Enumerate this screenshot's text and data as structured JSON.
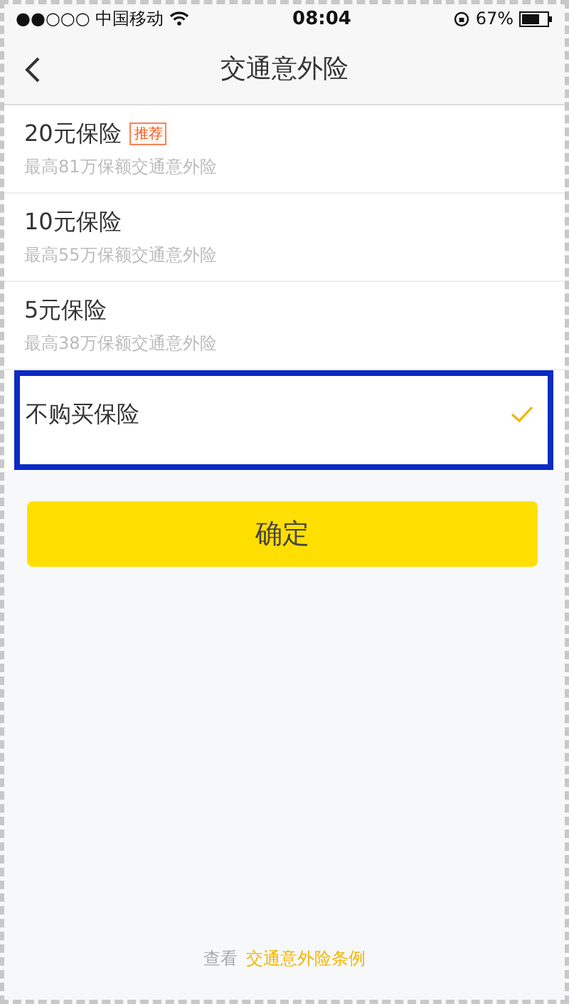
{
  "status_bar": {
    "carrier": "●●○○○ 中国移动",
    "time": "08:04",
    "battery": "67%"
  },
  "nav": {
    "title": "交通意外险"
  },
  "options": [
    {
      "title": "20元保险",
      "badge": "推荐",
      "subtitle": "最高81万保额交通意外险",
      "selected": false
    },
    {
      "title": "10元保险",
      "subtitle": "最高55万保额交通意外险",
      "selected": false
    },
    {
      "title": "5元保险",
      "subtitle": "最高38万保额交通意外险",
      "selected": false
    },
    {
      "title": "不购买保险",
      "selected": true
    }
  ],
  "confirm_button": "确定",
  "footer": {
    "prefix": "查看",
    "link": "交通意外险条例"
  }
}
